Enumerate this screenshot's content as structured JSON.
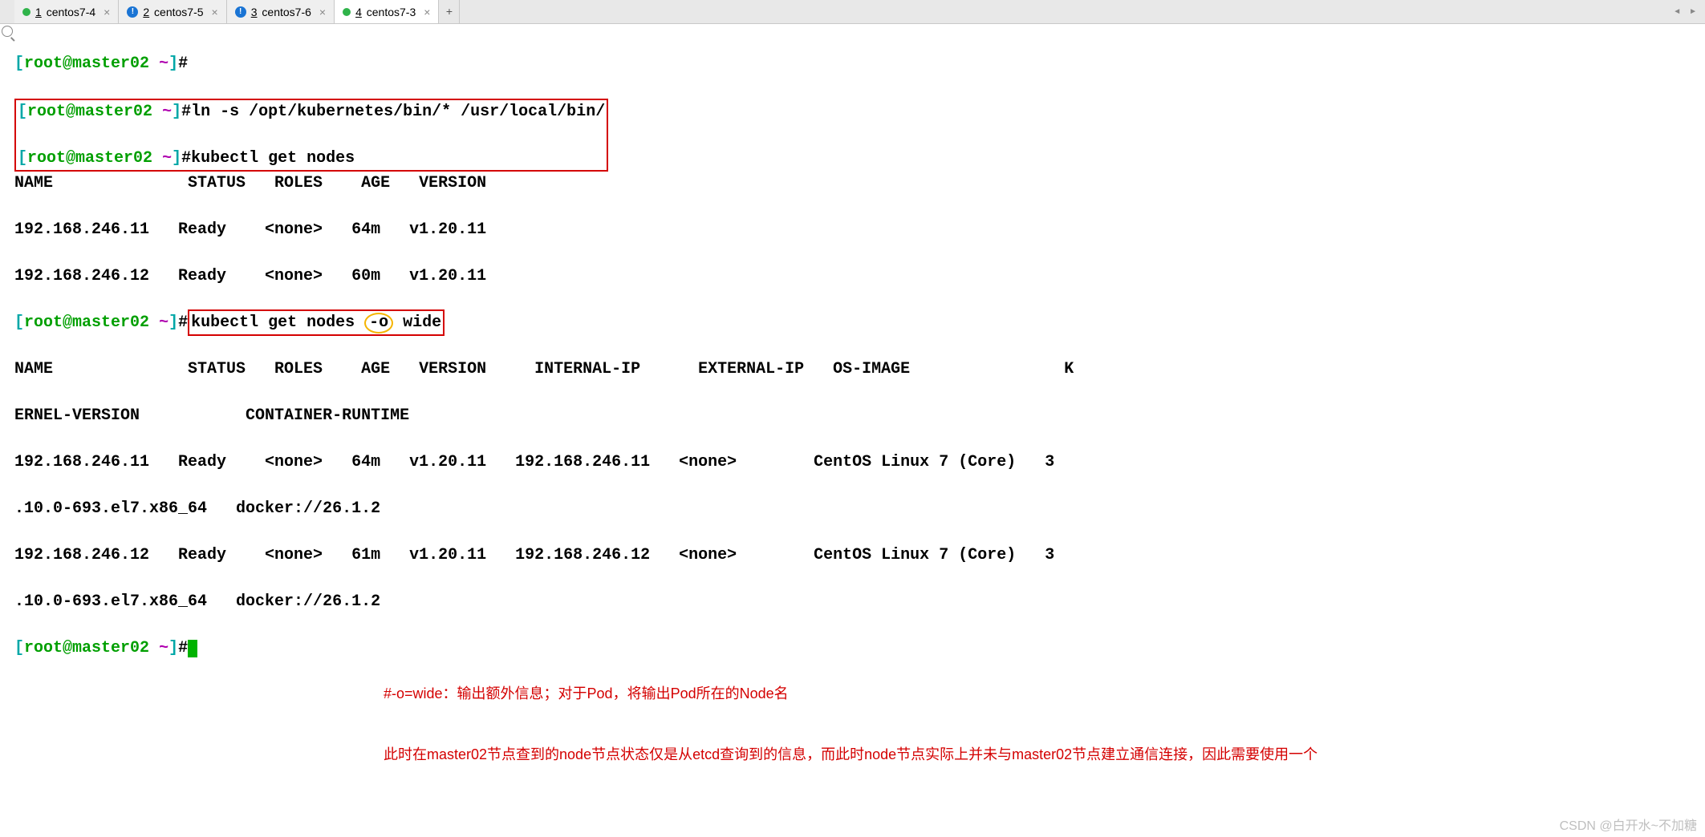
{
  "tabs": [
    {
      "kind": "green",
      "num": "1",
      "name": "centos7-4",
      "active": false
    },
    {
      "kind": "info",
      "num": "2",
      "name": "centos7-5",
      "active": false
    },
    {
      "kind": "info",
      "num": "3",
      "name": "centos7-6",
      "active": false
    },
    {
      "kind": "green",
      "num": "4",
      "name": "centos7-3",
      "active": true
    }
  ],
  "tab_close": "×",
  "tab_add": "+",
  "prompt": {
    "open": "[",
    "user": "root@master02",
    "space": " ",
    "tilde": "~",
    "close": "]",
    "hash": "#"
  },
  "cmd1": "ln -s /opt/kubernetes/bin/* /usr/local/bin/",
  "cmd2": "kubectl get nodes",
  "nodes_header": "NAME              STATUS   ROLES    AGE   VERSION",
  "nodes_row1": "192.168.246.11   Ready    <none>   64m   v1.20.11",
  "nodes_row2": "192.168.246.12   Ready    <none>   60m   v1.20.11",
  "cmd3_a": "kubectl get nodes ",
  "cmd3_flag": "-o",
  "cmd3_b": " wide",
  "wide_header1": "NAME              STATUS   ROLES    AGE   VERSION     INTERNAL-IP      EXTERNAL-IP   OS-IMAGE                K",
  "wide_header2": "ERNEL-VERSION           CONTAINER-RUNTIME",
  "wide_row1a": "192.168.246.11   Ready    <none>   64m   v1.20.11   192.168.246.11   <none>        CentOS Linux 7 (Core)   3",
  "wide_row1b": ".10.0-693.el7.x86_64   docker://26.1.2",
  "wide_row2a": "192.168.246.12   Ready    <none>   61m   v1.20.11   192.168.246.12   <none>        CentOS Linux 7 (Core)   3",
  "wide_row2b": ".10.0-693.el7.x86_64   docker://26.1.2",
  "note1": "#-o=wide：输出额外信息；对于Pod，将输出Pod所在的Node名",
  "note2": "此时在master02节点查到的node节点状态仅是从etcd查询到的信息，而此时node节点实际上并未与master02节点建立通信连接，因此需要使用一个",
  "watermark": "CSDN @白开水~不加糖"
}
